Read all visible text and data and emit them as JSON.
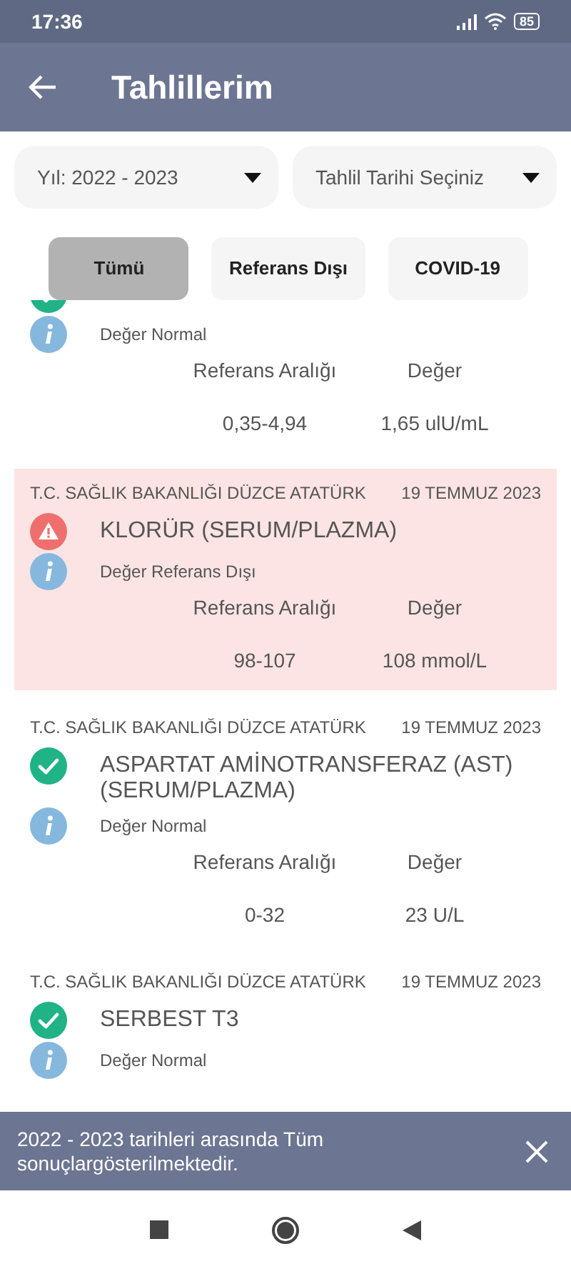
{
  "status_bar": {
    "time": "17:36",
    "battery": "85"
  },
  "app_bar": {
    "title": "Tahlillerim"
  },
  "dropdowns": [
    {
      "value": "Yıl: 2022 - 2023"
    },
    {
      "value": "Tahlil Tarihi Seçiniz"
    }
  ],
  "filters": [
    {
      "label": "Tümü",
      "selected": true
    },
    {
      "label": "Referans Dışı",
      "selected": false
    },
    {
      "label": "COVID-19",
      "selected": false
    }
  ],
  "results": [
    {
      "kind": "normal",
      "status": "Değer Normal",
      "range_label": "Referans Aralığı",
      "value_label": "Değer",
      "range": "0,35-4,94",
      "value": "1,65 ulU/mL"
    },
    {
      "kind": "out",
      "hospital": "T.C. SAĞLIK BAKANLIĞI DÜZCE ATATÜRK",
      "date": "19 TEMMUZ 2023",
      "name": "KLORÜR (SERUM/PLAZMA)",
      "status": "Değer Referans Dışı",
      "range_label": "Referans Aralığı",
      "value_label": "Değer",
      "range": "98-107",
      "value": "108 mmol/L"
    },
    {
      "kind": "normal",
      "hospital": "T.C. SAĞLIK BAKANLIĞI DÜZCE ATATÜRK",
      "date": "19 TEMMUZ 2023",
      "name": "ASPARTAT AMİNOTRANSFERAZ (AST) (SERUM/PLAZMA)",
      "status": "Değer Normal",
      "range_label": "Referans Aralığı",
      "value_label": "Değer",
      "range": "0-32",
      "value": "23 U/L"
    },
    {
      "kind": "normal",
      "hospital": "T.C. SAĞLIK BAKANLIĞI DÜZCE ATATÜRK",
      "date": "19 TEMMUZ 2023",
      "name": "SERBEST T3",
      "status": "Değer Normal"
    }
  ],
  "snackbar": {
    "message": "2022 - 2023 tarihleri arasında Tüm sonuçlargösterilmektedir."
  }
}
